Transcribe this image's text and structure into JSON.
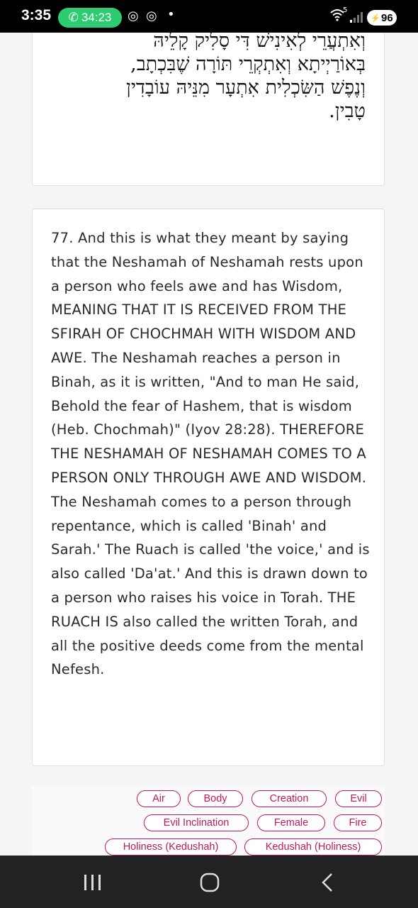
{
  "status_bar": {
    "time": "3:35",
    "call_duration": "34:23",
    "battery": "96",
    "signal_label": "5"
  },
  "hebrew": {
    "lines": "וְאִתְעֲרֵי לְאִינִישׁ דִּי סָלִיק קָלֵיהּ\nבְּאוֹרַיְיתָא וְאִתְקְרֵי תּוֹרָה שֶׁבִּכְתָב,\nוְנֶפֶשׁ הַשִּׂכְלִית אִתְעָר מִנֵּיהּ עוֹבָדִין\nטָבִין."
  },
  "translation": {
    "text": "77. And this is what they meant by saying that the Neshamah of Neshamah rests upon a person who feels awe and has Wisdom, MEANING THAT IT IS RECEIVED FROM THE SFIRAH OF CHOCHMAH WITH WISDOM AND AWE. The Neshamah reaches a person in Binah, as it is written, \"And to man He said, Behold the fear of Hashem, that is wisdom (Heb. Chochmah)\" (Iyov 28:28). THEREFORE THE NESHAMAH OF NESHAMAH COMES TO A PERSON ONLY THROUGH AWE AND WISDOM. The Neshamah comes to a person through repentance, which is called 'Binah' and Sarah.' The Ruach is called 'the voice,' and is also called 'Da'at.' And this is drawn down to a person who raises his voice in Torah. THE RUACH IS also called the written Torah, and all the positive deeds come from the mental Nefesh."
  },
  "tags": [
    "Air",
    "Body",
    "Creation",
    "Evil",
    "Evil Inclination",
    "Female",
    "Fire",
    "Holiness (Kedushah)",
    "Kedushah (Holiness)"
  ],
  "colors": {
    "tag_accent": "#c2185b",
    "call_green": "#2ecc71"
  }
}
